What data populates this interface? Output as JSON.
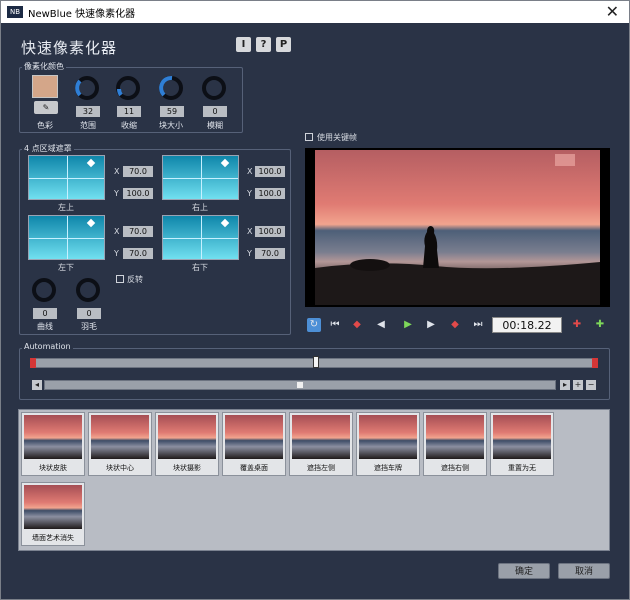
{
  "window": {
    "title": "NewBlue 快速像素化器",
    "icon_text": "NB",
    "close_icon": "close-icon"
  },
  "heading": "快速像素化器",
  "top_buttons": [
    "I",
    "?",
    "P"
  ],
  "pixel_color": {
    "group_label": "像素化颜色",
    "swatch_color": "#d4a689",
    "color_label": "色彩",
    "knobs": [
      {
        "value": "32",
        "label": "范围"
      },
      {
        "value": "11",
        "label": "收缩"
      },
      {
        "value": "59",
        "label": "块大小"
      },
      {
        "value": "0",
        "label": "模糊"
      }
    ]
  },
  "mask": {
    "group_label": "4 点区域遮罩",
    "areas": [
      {
        "label": "左上",
        "x": "70.0",
        "y": "100.0"
      },
      {
        "label": "右上",
        "x": "100.0",
        "y": "100.0"
      },
      {
        "label": "左下",
        "x": "70.0",
        "y": "70.0"
      },
      {
        "label": "右下",
        "x": "100.0",
        "y": "70.0"
      }
    ],
    "x_label": "X",
    "y_label": "Y",
    "invert_label": "反转",
    "curve": {
      "value": "0",
      "label": "曲线"
    },
    "feather": {
      "value": "0",
      "label": "羽毛"
    }
  },
  "keyframe_label": "使用关键帧",
  "transport": {
    "timecode": "00:18.22"
  },
  "automation": {
    "label": "Automation"
  },
  "presets": [
    {
      "label": "块状皮肤"
    },
    {
      "label": "块状中心"
    },
    {
      "label": "块状摄影"
    },
    {
      "label": "覆盖桌面"
    },
    {
      "label": "遮挡左侧"
    },
    {
      "label": "遮挡车牌"
    },
    {
      "label": "遮挡右侧"
    },
    {
      "label": "重置为无"
    },
    {
      "label": "墙面艺术消失"
    }
  ],
  "buttons": {
    "ok": "确定",
    "cancel": "取消"
  }
}
